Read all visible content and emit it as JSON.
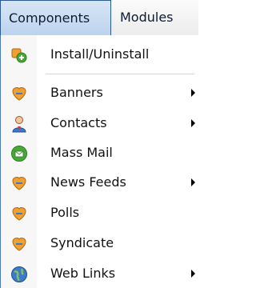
{
  "menubar": {
    "items": [
      {
        "label": "Components",
        "active": true
      },
      {
        "label": "Modules",
        "active": false
      }
    ]
  },
  "dropdown": {
    "items": [
      {
        "label": "Install/Uninstall",
        "icon": "install-icon",
        "submenu": false
      },
      {
        "label": "Banners",
        "icon": "component-icon",
        "submenu": true
      },
      {
        "label": "Contacts",
        "icon": "contacts-icon",
        "submenu": true
      },
      {
        "label": "Mass Mail",
        "icon": "mass-mail-icon",
        "submenu": false
      },
      {
        "label": "News Feeds",
        "icon": "component-icon",
        "submenu": true
      },
      {
        "label": "Polls",
        "icon": "component-icon",
        "submenu": false
      },
      {
        "label": "Syndicate",
        "icon": "component-icon",
        "submenu": false
      },
      {
        "label": "Web Links",
        "icon": "globe-icon",
        "submenu": true
      }
    ]
  },
  "colors": {
    "active_menu_border": "#2c5a96",
    "active_menu_bg": "#c8dcf2",
    "icon_orange": "#f0a030",
    "icon_blue": "#3f79c9",
    "icon_green": "#4aa838"
  }
}
